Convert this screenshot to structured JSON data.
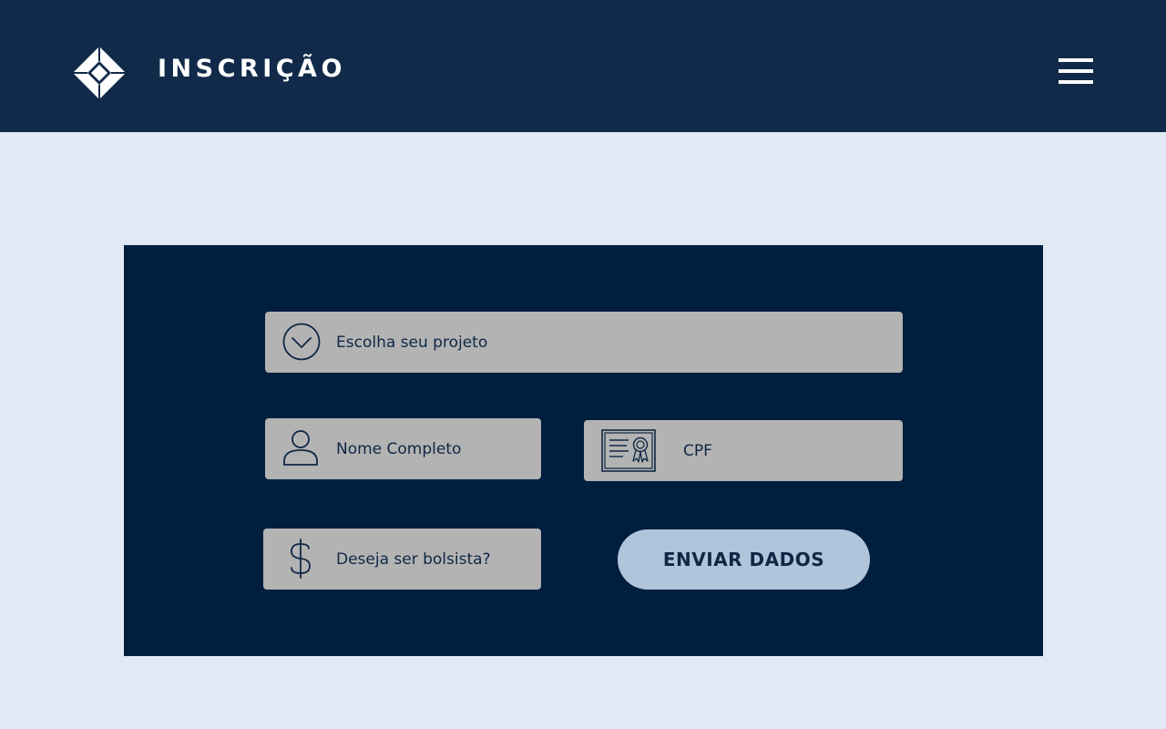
{
  "header": {
    "title": "INSCRIÇÃO",
    "logo_icon": "diamond-logo-icon",
    "menu_icon": "hamburger-menu-icon"
  },
  "form": {
    "project_select": {
      "placeholder": "Escolha seu projeto",
      "icon": "chevron-down-circle-icon"
    },
    "name_field": {
      "placeholder": "Nome Completo",
      "icon": "user-icon"
    },
    "cpf_field": {
      "placeholder": "CPF",
      "icon": "certificate-icon"
    },
    "scholarship_field": {
      "placeholder": "Deseja ser bolsista?",
      "icon": "dollar-icon"
    },
    "submit_label": "ENVIAR DADOS"
  },
  "colors": {
    "header_bg": "#112A4A",
    "page_bg": "#E1EAF4",
    "panel_bg": "#001E3E",
    "field_bg": "#B3B3B3",
    "button_bg": "#B0C4DC",
    "text_dark": "#0F2744"
  }
}
